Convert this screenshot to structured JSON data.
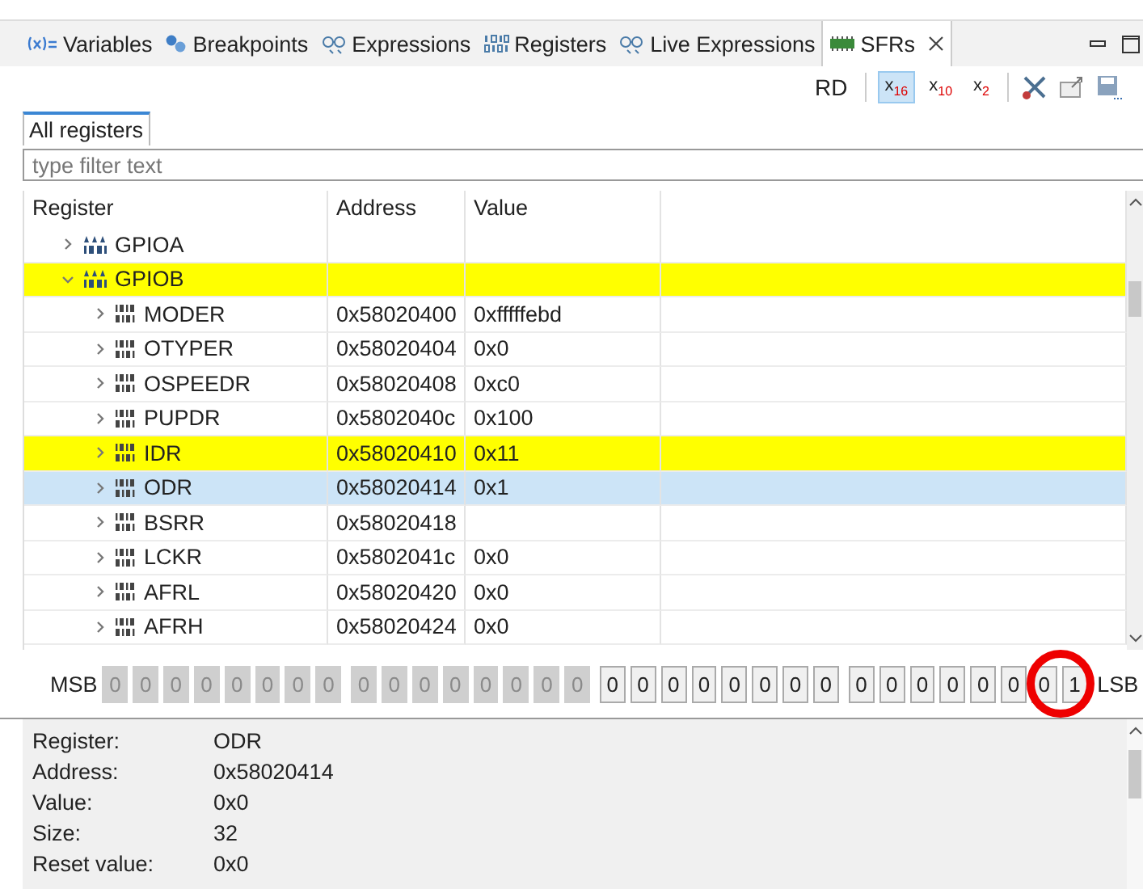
{
  "view_tabs": [
    {
      "label": "Variables",
      "kind": "variables",
      "selected": false
    },
    {
      "label": "Breakpoints",
      "kind": "breakpoints",
      "selected": false
    },
    {
      "label": "Expressions",
      "kind": "expressions",
      "selected": false
    },
    {
      "label": "Registers",
      "kind": "registers",
      "selected": false
    },
    {
      "label": "Live Expressions",
      "kind": "expressions",
      "selected": false
    },
    {
      "label": "SFRs",
      "kind": "sfr",
      "selected": true
    }
  ],
  "toolbar": [
    {
      "kind": "text",
      "label": "RD",
      "selected": false
    },
    {
      "kind": "radix",
      "label": "x",
      "sub": "16",
      "selected": true
    },
    {
      "kind": "radix",
      "label": "x",
      "sub": "10",
      "selected": false
    },
    {
      "kind": "radix",
      "label": "x",
      "sub": "2",
      "selected": false
    },
    {
      "kind": "tools",
      "selected": false
    },
    {
      "kind": "export",
      "selected": false
    },
    {
      "kind": "save",
      "selected": false
    }
  ],
  "sub_tabs": [
    {
      "label": "All registers",
      "selected": true
    }
  ],
  "filter": {
    "placeholder": "type filter text"
  },
  "table": {
    "columns": [
      "Register",
      "Address",
      "Value"
    ],
    "rows": [
      {
        "name": "GPIOA",
        "kind": "peripheral",
        "expanded": false,
        "changed": false,
        "selected": false
      },
      {
        "name": "GPIOB",
        "kind": "peripheral",
        "expanded": true,
        "changed": true,
        "selected": false,
        "children": [
          {
            "name": "MODER",
            "kind": "register",
            "address": "0x58020400",
            "value": "0xfffffebd",
            "expanded": false,
            "changed": false,
            "selected": false
          },
          {
            "name": "OTYPER",
            "kind": "register",
            "address": "0x58020404",
            "value": "0x0",
            "expanded": false,
            "changed": false,
            "selected": false
          },
          {
            "name": "OSPEEDR",
            "kind": "register",
            "address": "0x58020408",
            "value": "0xc0",
            "expanded": false,
            "changed": false,
            "selected": false
          },
          {
            "name": "PUPDR",
            "kind": "register",
            "address": "0x5802040c",
            "value": "0x100",
            "expanded": false,
            "changed": false,
            "selected": false
          },
          {
            "name": "IDR",
            "kind": "register",
            "address": "0x58020410",
            "value": "0x11",
            "expanded": false,
            "changed": true,
            "selected": false
          },
          {
            "name": "ODR",
            "kind": "register",
            "address": "0x58020414",
            "value": "0x1",
            "expanded": false,
            "changed": false,
            "selected": true
          },
          {
            "name": "BSRR",
            "kind": "register",
            "address": "0x58020418",
            "expanded": false,
            "changed": false,
            "selected": false
          },
          {
            "name": "LCKR",
            "kind": "register",
            "address": "0x5802041c",
            "value": "0x0",
            "expanded": false,
            "changed": false,
            "selected": false
          },
          {
            "name": "AFRL",
            "kind": "register",
            "address": "0x58020420",
            "value": "0x0",
            "expanded": false,
            "changed": false,
            "selected": false
          },
          {
            "name": "AFRH",
            "kind": "register",
            "address": "0x58020424",
            "value": "0x0",
            "expanded": false,
            "changed": false,
            "selected": false
          }
        ]
      }
    ]
  },
  "bits": {
    "msb_label": "MSB",
    "lsb_label": "LSB",
    "values": [
      {
        "value": "0",
        "disabled": true
      },
      {
        "value": "0",
        "disabled": true
      },
      {
        "value": "0",
        "disabled": true
      },
      {
        "value": "0",
        "disabled": true
      },
      {
        "value": "0",
        "disabled": true
      },
      {
        "value": "0",
        "disabled": true
      },
      {
        "value": "0",
        "disabled": true
      },
      {
        "value": "0",
        "disabled": true
      },
      {
        "value": "0",
        "disabled": true
      },
      {
        "value": "0",
        "disabled": true
      },
      {
        "value": "0",
        "disabled": true
      },
      {
        "value": "0",
        "disabled": true
      },
      {
        "value": "0",
        "disabled": true
      },
      {
        "value": "0",
        "disabled": true
      },
      {
        "value": "0",
        "disabled": true
      },
      {
        "value": "0",
        "disabled": true
      },
      {
        "value": "0",
        "disabled": false
      },
      {
        "value": "0",
        "disabled": false
      },
      {
        "value": "0",
        "disabled": false
      },
      {
        "value": "0",
        "disabled": false
      },
      {
        "value": "0",
        "disabled": false
      },
      {
        "value": "0",
        "disabled": false
      },
      {
        "value": "0",
        "disabled": false
      },
      {
        "value": "0",
        "disabled": false
      },
      {
        "value": "0",
        "disabled": false
      },
      {
        "value": "0",
        "disabled": false
      },
      {
        "value": "0",
        "disabled": false
      },
      {
        "value": "0",
        "disabled": false
      },
      {
        "value": "0",
        "disabled": false
      },
      {
        "value": "0",
        "disabled": false
      },
      {
        "value": "0",
        "disabled": false
      },
      {
        "value": "1",
        "disabled": false
      }
    ]
  },
  "details": [
    {
      "label": "Register:",
      "value": "ODR"
    },
    {
      "label": "Address:",
      "value": "0x58020414"
    },
    {
      "label": "Value:",
      "value": "0x0"
    },
    {
      "label": "Size:",
      "value": "32"
    },
    {
      "label": "Reset value:",
      "value": "0x0"
    }
  ]
}
